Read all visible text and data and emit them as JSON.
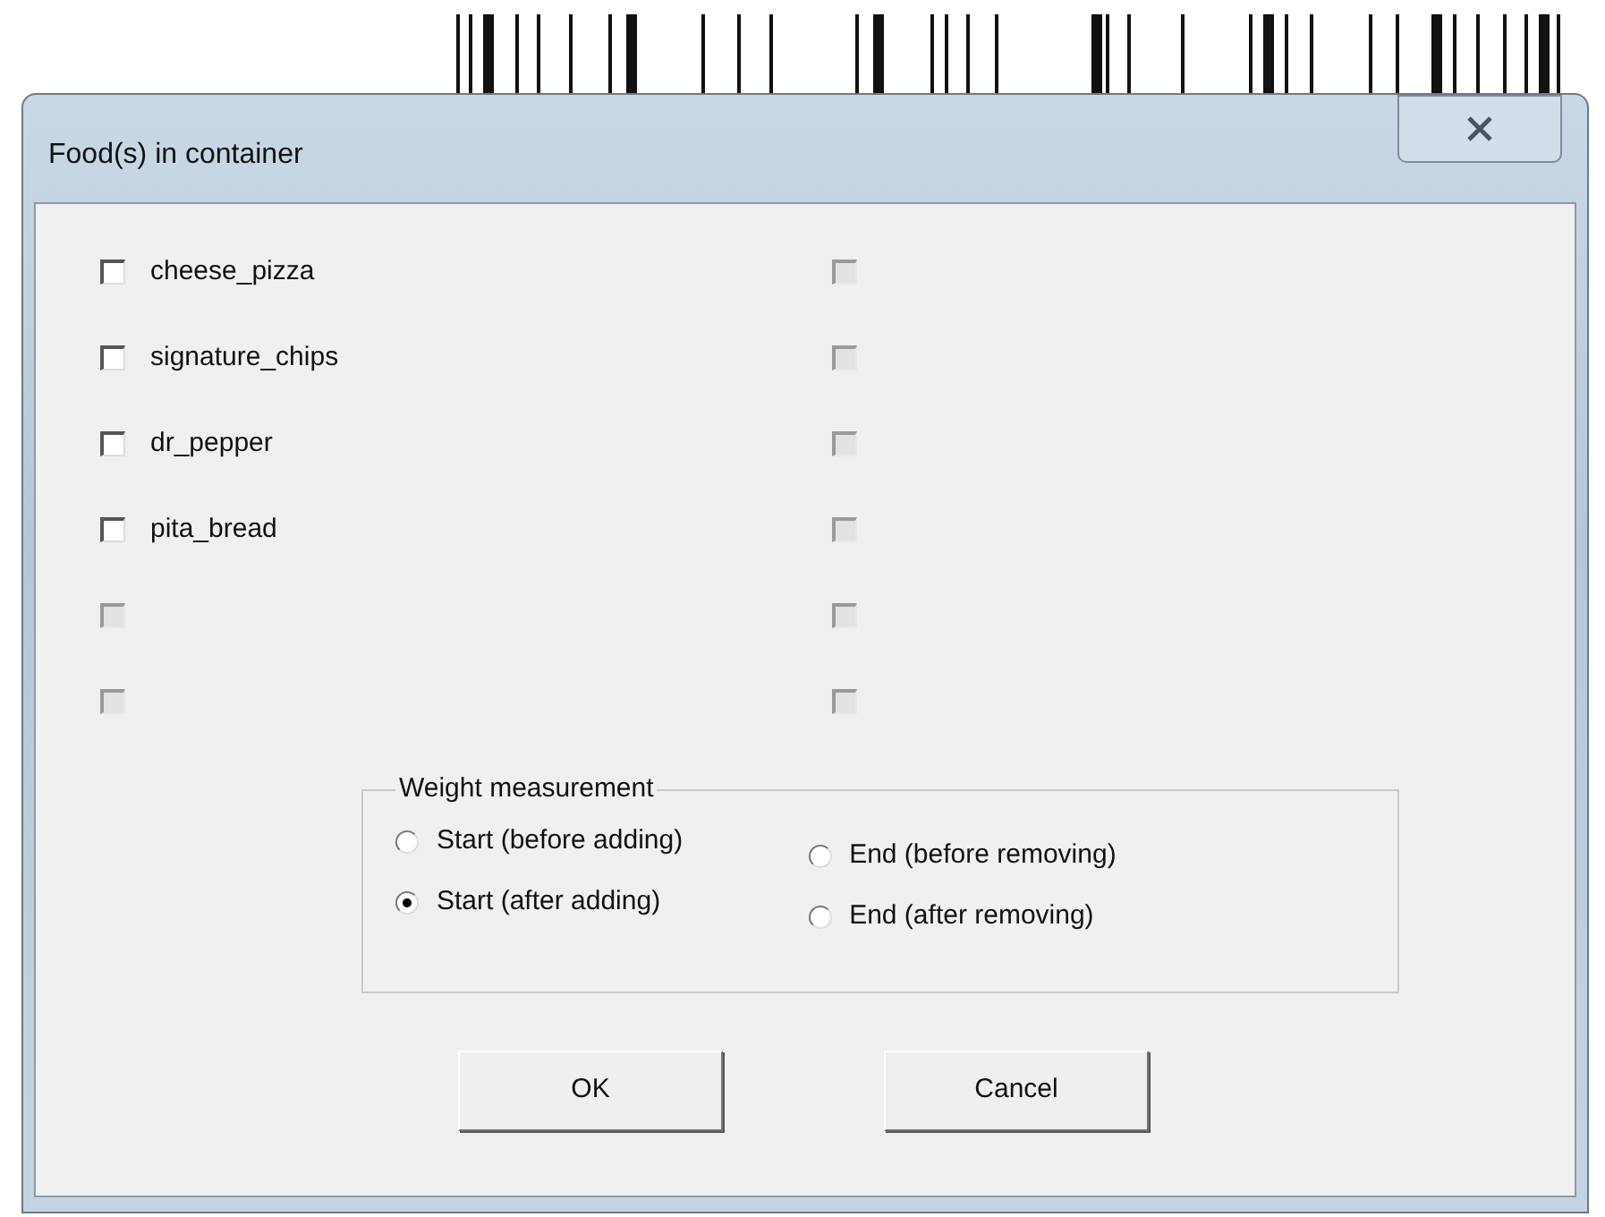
{
  "window": {
    "title": "Food(s) in container"
  },
  "checkbox_columns": [
    [
      {
        "label": "cheese_pizza",
        "checked": false,
        "disabled": false
      },
      {
        "label": "signature_chips",
        "checked": false,
        "disabled": false
      },
      {
        "label": "dr_pepper",
        "checked": false,
        "disabled": false
      },
      {
        "label": "pita_bread",
        "checked": false,
        "disabled": false
      },
      {
        "checked": false,
        "disabled": true
      },
      {
        "checked": false,
        "disabled": true
      }
    ],
    [
      {
        "checked": false,
        "disabled": true
      },
      {
        "checked": false,
        "disabled": true
      },
      {
        "checked": false,
        "disabled": true
      },
      {
        "checked": false,
        "disabled": true
      },
      {
        "checked": false,
        "disabled": true
      },
      {
        "checked": false,
        "disabled": true
      }
    ]
  ],
  "weight_measurement": {
    "title": "Weight measurement",
    "columns": [
      [
        {
          "label": "Start (before adding)",
          "selected": false
        },
        {
          "label": "Start (after adding)",
          "selected": true
        }
      ],
      [
        {
          "label": "End (before removing)",
          "selected": false
        },
        {
          "label": "End (after removing)",
          "selected": false
        }
      ]
    ]
  },
  "buttons": [
    "OK",
    "Cancel"
  ]
}
